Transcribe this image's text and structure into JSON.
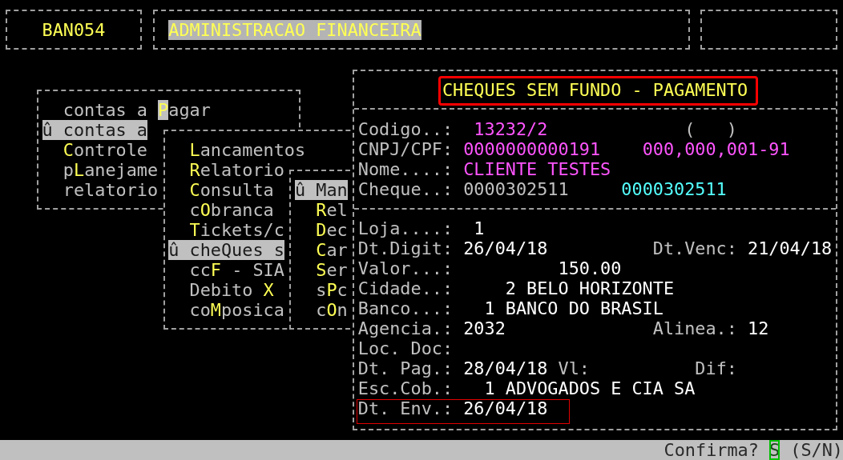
{
  "header": {
    "code": "BAN054",
    "title": "ADMINISTRACAO FINANCEIRA"
  },
  "menus": [
    {
      "items": [
        {
          "pre": "contas a ",
          "key": "P",
          "post": "agar",
          "selected": false,
          "cursor": true
        },
        {
          "marker": "û",
          "pre": "contas a",
          "selected": true
        },
        {
          "key": "C",
          "post": "ontrole",
          "selected": false
        },
        {
          "pre": "p",
          "key": "L",
          "post": "anejame",
          "selected": false
        },
        {
          "pre": "relatorio",
          "selected": false
        }
      ]
    },
    {
      "items": [
        {
          "key": "L",
          "post": "ancamentos",
          "selected": false
        },
        {
          "key": "R",
          "post": "elatorio",
          "selected": false
        },
        {
          "key": "C",
          "post": "onsulta",
          "selected": false
        },
        {
          "pre": "c",
          "key": "O",
          "post": "branca",
          "selected": false
        },
        {
          "key": "T",
          "post": "ickets/c",
          "selected": false
        },
        {
          "marker": "û",
          "pre": "cheQues s",
          "selected": true
        },
        {
          "pre": "cc",
          "key": "F",
          "post": " - SIA",
          "selected": false
        },
        {
          "pre": "Debito ",
          "key": "X",
          "selected": false
        },
        {
          "pre": "co",
          "key": "M",
          "post": "posica",
          "selected": false
        }
      ]
    },
    {
      "items": [
        {
          "marker": "û",
          "pre": "Man",
          "selected": true
        },
        {
          "key": "R",
          "post": "el",
          "selected": false
        },
        {
          "key": "D",
          "post": "ec",
          "selected": false
        },
        {
          "key": "C",
          "post": "ar",
          "selected": false
        },
        {
          "key": "S",
          "post": "er",
          "selected": false
        },
        {
          "pre": "s",
          "key": "P",
          "post": "c",
          "selected": false
        },
        {
          "pre": "c",
          "key": "O",
          "post": "n",
          "selected": false
        }
      ]
    }
  ],
  "dialog": {
    "title": "CHEQUES SEM FUNDO - PAGAMENTO",
    "sections": [
      {
        "rows": [
          {
            "label": "Codigo..:",
            "value": {
              "text": "13232/2",
              "kind": "client"
            },
            "value_2": {
              "text": "(   )",
              "kind": "plain"
            }
          },
          {
            "label": "CNPJ/CPF:",
            "value": {
              "text": "0000000000191",
              "kind": "client"
            },
            "value_2": {
              "text": "000,000,001-91",
              "kind": "client"
            }
          },
          {
            "label": "Nome....:",
            "value": {
              "text": "CLIENTE TESTES",
              "kind": "client"
            }
          },
          {
            "label": "Cheque..:",
            "value": {
              "text": "0000302511",
              "kind": "plain"
            },
            "value_2": {
              "text": "0000302511",
              "kind": "account"
            }
          }
        ]
      },
      {
        "rows": [
          {
            "label": "Loja....:",
            "value": {
              "text": "1",
              "kind": "value"
            }
          },
          {
            "label": "Dt.Digit:",
            "value": {
              "text": "26/04/18",
              "kind": "value"
            },
            "label_2": "Dt.Venc:",
            "value_2": {
              "text": "21/04/18",
              "kind": "value"
            }
          },
          {
            "label": "Valor...:",
            "value": {
              "text": "150.00",
              "kind": "value"
            }
          },
          {
            "label": "Cidade..:",
            "value": {
              "text": "2 BELO HORIZONTE",
              "kind": "value"
            }
          },
          {
            "label": "Banco...:",
            "value": {
              "text": "1 BANCO DO BRASIL",
              "kind": "value"
            }
          },
          {
            "label": "Agencia.:",
            "value": {
              "text": "2032",
              "kind": "value"
            },
            "label_2": "Alinea.:",
            "value_2": {
              "text": "12",
              "kind": "value"
            }
          },
          {
            "label": "Loc. Doc:"
          },
          {
            "label": "Dt. Pag.:",
            "value": {
              "text": "28/04/18",
              "kind": "value"
            },
            "label_2": "Vl:",
            "label_3": "Dif:"
          },
          {
            "label": "Esc.Cob.:",
            "value": {
              "text": "1 ADVOGADOS E CIA SA",
              "kind": "value"
            }
          },
          {
            "label": "Dt. Env.:",
            "value": {
              "text": "26/04/18",
              "kind": "value"
            }
          }
        ]
      }
    ]
  },
  "status_bar": {
    "prompt": "Confirma?",
    "answer": "S",
    "options": "(S/N)"
  }
}
